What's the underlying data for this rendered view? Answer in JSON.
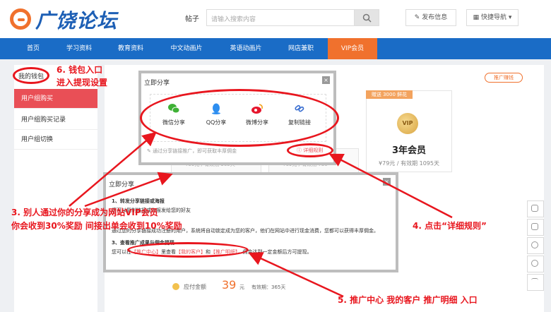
{
  "header": {
    "logo": "广饶论坛",
    "search_label": "帖子",
    "search_placeholder": "请输入搜索内容",
    "publish": "发布信息",
    "quick_nav": "快捷导航"
  },
  "nav": [
    "首页",
    "学习资料",
    "教育资料",
    "中文动画片",
    "英语动画片",
    "网店兼职",
    "VIP会员"
  ],
  "nav_active": "VIP会员",
  "sidebar": {
    "wallet": "我的钱包",
    "items": [
      "用户组购买",
      "用户组购买记录",
      "用户组切换"
    ]
  },
  "content": {
    "promo_badge": "推广赚钱",
    "gift_badge": "赠送 3000 鲜花",
    "vip_icon": "VIP",
    "vip_name": "3年会员",
    "vip_price": "¥79元 / 有效期 1095天",
    "ghost_price_1": "¥59元 / 有效期 365天",
    "ghost_price_2": "¥69元 / 有效期 730",
    "pay_label": "应付金额",
    "pay_amount": "39",
    "pay_unit": "元",
    "pay_validity": "有效期：365天"
  },
  "popup1": {
    "title": "立即分享",
    "close": "×",
    "share": [
      "微信分享",
      "QQ分享",
      "微博分享",
      "复制链接"
    ],
    "hint": "通过分享链接推广，即可获取丰厚佣金",
    "rules": "详细规则"
  },
  "popup2": {
    "title": "立即分享",
    "close": "×",
    "step1": "1、转发分享链接或海报",
    "step1_desc": "您可以复制链接或海报发给您的好友",
    "step2_desc": "通过您的分享链接成功注册的用户，系统将自动锁定成为您的客户，他们在网站中进行现金消费，您都可以获得丰厚佣金。",
    "step3": "3、查看推广成果与佣金提现",
    "step3_pre": "您可以在",
    "link1": "【推广中心】",
    "mid1": "里查看",
    "link2": "【我的客户】",
    "mid2": "和",
    "link3": "【推广明细】",
    "step3_post": "，佣金达到一定金额后方可提现。"
  },
  "annotations": {
    "a3_line1": "3. 别人通过你的分享成为网站VIP会员",
    "a3_line2": "你会收到30%奖励  间接出单会收到10%奖励",
    "a4": "4. 点击“详细规则”",
    "a5": "5. 推广中心  我的客户  推广明细  入口",
    "a6_line1": "6. 钱包入口",
    "a6_line2": "进入提现设置"
  },
  "colors": {
    "brand_blue": "#1a6cc6",
    "accent_orange": "#f0712d",
    "annotation_red": "#e8161e",
    "sidebar_active": "#e94f56"
  },
  "icons": {
    "search": "search-icon",
    "publish": "edit-icon",
    "quick_nav": "grid-icon",
    "share": [
      "wechat-icon",
      "qq-icon",
      "weibo-icon",
      "link-icon"
    ],
    "tools": [
      "upload-icon",
      "edit-icon",
      "chat-icon",
      "refresh-icon",
      "top-icon"
    ]
  }
}
